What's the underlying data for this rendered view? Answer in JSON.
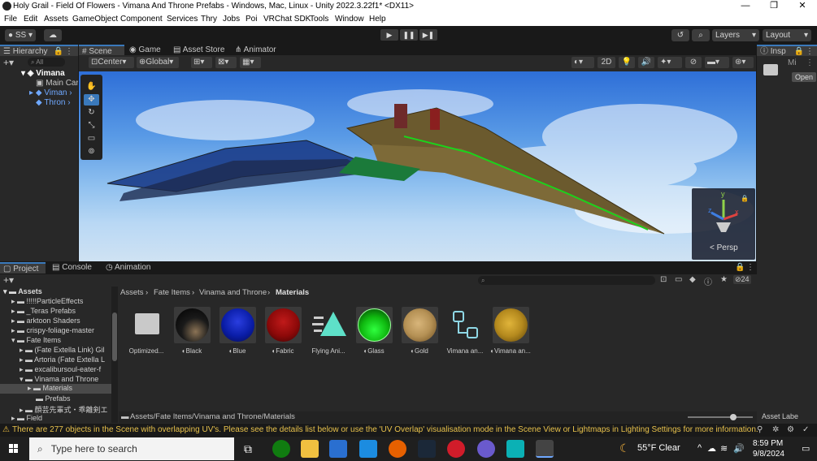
{
  "window": {
    "title": "Holy Grail - Field Of Flowers - Vimana And Throne Prefabs - Windows, Mac, Linux - Unity 2022.3.22f1* <DX11>",
    "controls": [
      "—",
      "❐",
      "✕"
    ]
  },
  "menu": [
    "File",
    "Edit",
    "Assets",
    "GameObject",
    "Component",
    "Services",
    "Thry",
    "Jobs",
    "Poi",
    "VRChat SDK",
    "Tools",
    "Window",
    "Help"
  ],
  "toolbar": {
    "account": "SS",
    "layers_label": "Layers",
    "layout_label": "Layout"
  },
  "hierarchy": {
    "tab": "Hierarchy",
    "search_placeholder": "All",
    "items": [
      "Vimana",
      "Main Car",
      "Viman",
      "Thron"
    ]
  },
  "scene_tabs": [
    "Scene",
    "Game",
    "Asset Store",
    "Animator"
  ],
  "scene_toolbar": {
    "pivot": "Center",
    "space": "Global",
    "mode_2d": "2D"
  },
  "gizmo": {
    "y": "y",
    "x": "x",
    "z": "z",
    "persp": "Persp"
  },
  "inspector": {
    "tab": "Insp",
    "object_label": "Mi",
    "open_button": "Open",
    "footer": "Asset Labe"
  },
  "bottom_tabs": [
    "Project",
    "Console",
    "Animation"
  ],
  "project": {
    "badge_count": "24",
    "tree": [
      {
        "label": "Assets",
        "depth": 0,
        "open": true
      },
      {
        "label": "!!!!!ParticleEffects",
        "depth": 1
      },
      {
        "label": "_Teras Prefabs",
        "depth": 1
      },
      {
        "label": "arktoon Shaders",
        "depth": 1
      },
      {
        "label": "crispy-foliage-master",
        "depth": 1
      },
      {
        "label": "Fate Items",
        "depth": 1,
        "open": true
      },
      {
        "label": "(Fate Extella Link) Gil",
        "depth": 2
      },
      {
        "label": "Artoria (Fate Extella L",
        "depth": 2
      },
      {
        "label": "excalibursoul-eater-f",
        "depth": 2
      },
      {
        "label": "Vinama and Throne",
        "depth": 2,
        "open": true
      },
      {
        "label": "Materials",
        "depth": 3,
        "selected": true
      },
      {
        "label": "Prefabs",
        "depth": 3
      },
      {
        "label": "顔芸先輩式・乖離剣エ",
        "depth": 2
      },
      {
        "label": "Field",
        "depth": 1
      }
    ],
    "breadcrumb": [
      "Assets",
      "Fate Items",
      "Vinama and Throne",
      "Materials"
    ],
    "assets": [
      {
        "label": "Optimized...",
        "kind": "folder"
      },
      {
        "label": "Black",
        "kind": "material",
        "color": "#1a1a1a"
      },
      {
        "label": "Blue",
        "kind": "material",
        "color": "#0a1da8"
      },
      {
        "label": "Fabric",
        "kind": "material",
        "color": "#8d0909"
      },
      {
        "label": "Flying Ani...",
        "kind": "anim"
      },
      {
        "label": "Glass",
        "kind": "material",
        "color": "#0fb80f"
      },
      {
        "label": "Gold",
        "kind": "material",
        "color": "#b59155"
      },
      {
        "label": "Vimana an...",
        "kind": "prefab"
      },
      {
        "label": "Vimana an...",
        "kind": "material",
        "color": "#b58a1e"
      }
    ],
    "path": "Assets/Fate Items/Vinama and Throne/Materials"
  },
  "status": "There are 277 objects in the Scene with overlapping UV's. Please see the details list below or use the 'UV Overlap' visualisation mode in the Scene View or Lightmaps in Lighting Settings for more information.",
  "taskbar": {
    "search_placeholder": "Type here to search",
    "weather": "55°F  Clear",
    "time": "8:59 PM",
    "date": "9/8/2024"
  }
}
